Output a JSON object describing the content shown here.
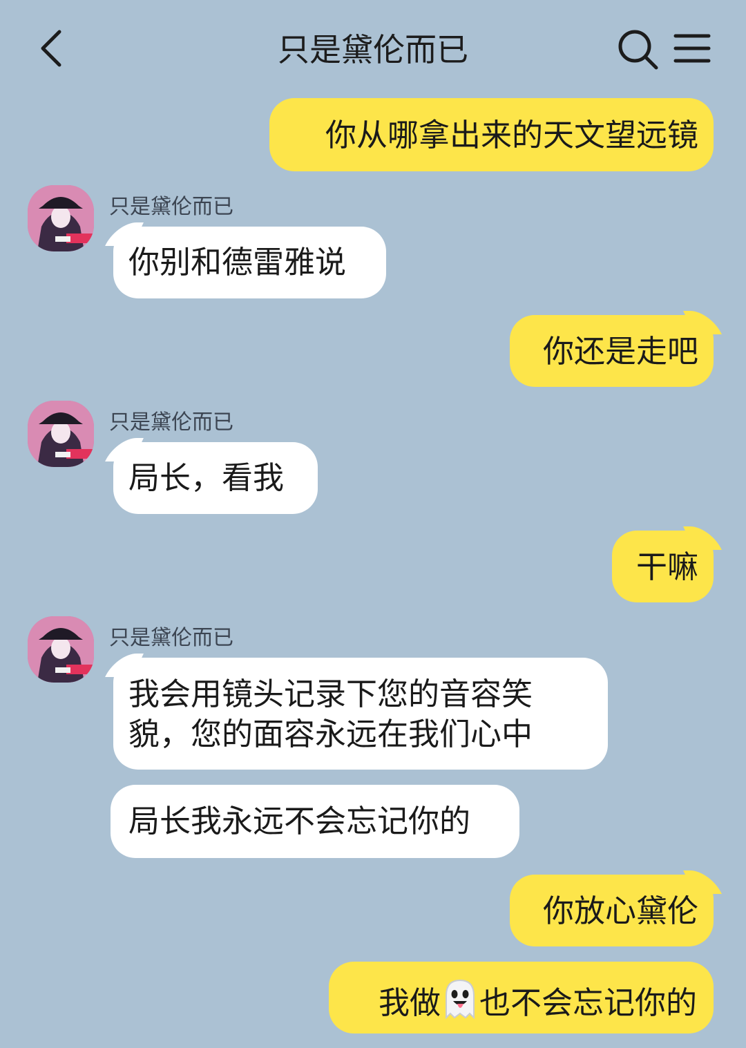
{
  "header": {
    "title": "只是黛伦而已",
    "back_icon": "chevron-left-icon",
    "search_icon": "search-icon",
    "menu_icon": "menu-icon"
  },
  "colors": {
    "background": "#abc1d3",
    "incoming_bubble": "#ffffff",
    "outgoing_bubble": "#fde54a"
  },
  "messages": [
    {
      "direction": "out",
      "text": "你从哪拿出来的天文望远镜"
    },
    {
      "direction": "in",
      "sender": "只是黛伦而已",
      "text": "你别和德雷雅说"
    },
    {
      "direction": "out",
      "text": "你还是走吧"
    },
    {
      "direction": "in",
      "sender": "只是黛伦而已",
      "text": "局长，看我"
    },
    {
      "direction": "out",
      "text": "干嘛"
    },
    {
      "direction": "in",
      "sender": "只是黛伦而已",
      "lines": [
        "我会用镜头记录下您的音容笑",
        "貌，您的面容永远在我们心中"
      ]
    },
    {
      "direction": "in",
      "text": "局长我永远不会忘记你的"
    },
    {
      "direction": "out",
      "text": "你放心黛伦"
    },
    {
      "direction": "out",
      "text_before": "我做",
      "emoji": "ghost-icon",
      "text_after": "也不会忘记你的"
    }
  ]
}
